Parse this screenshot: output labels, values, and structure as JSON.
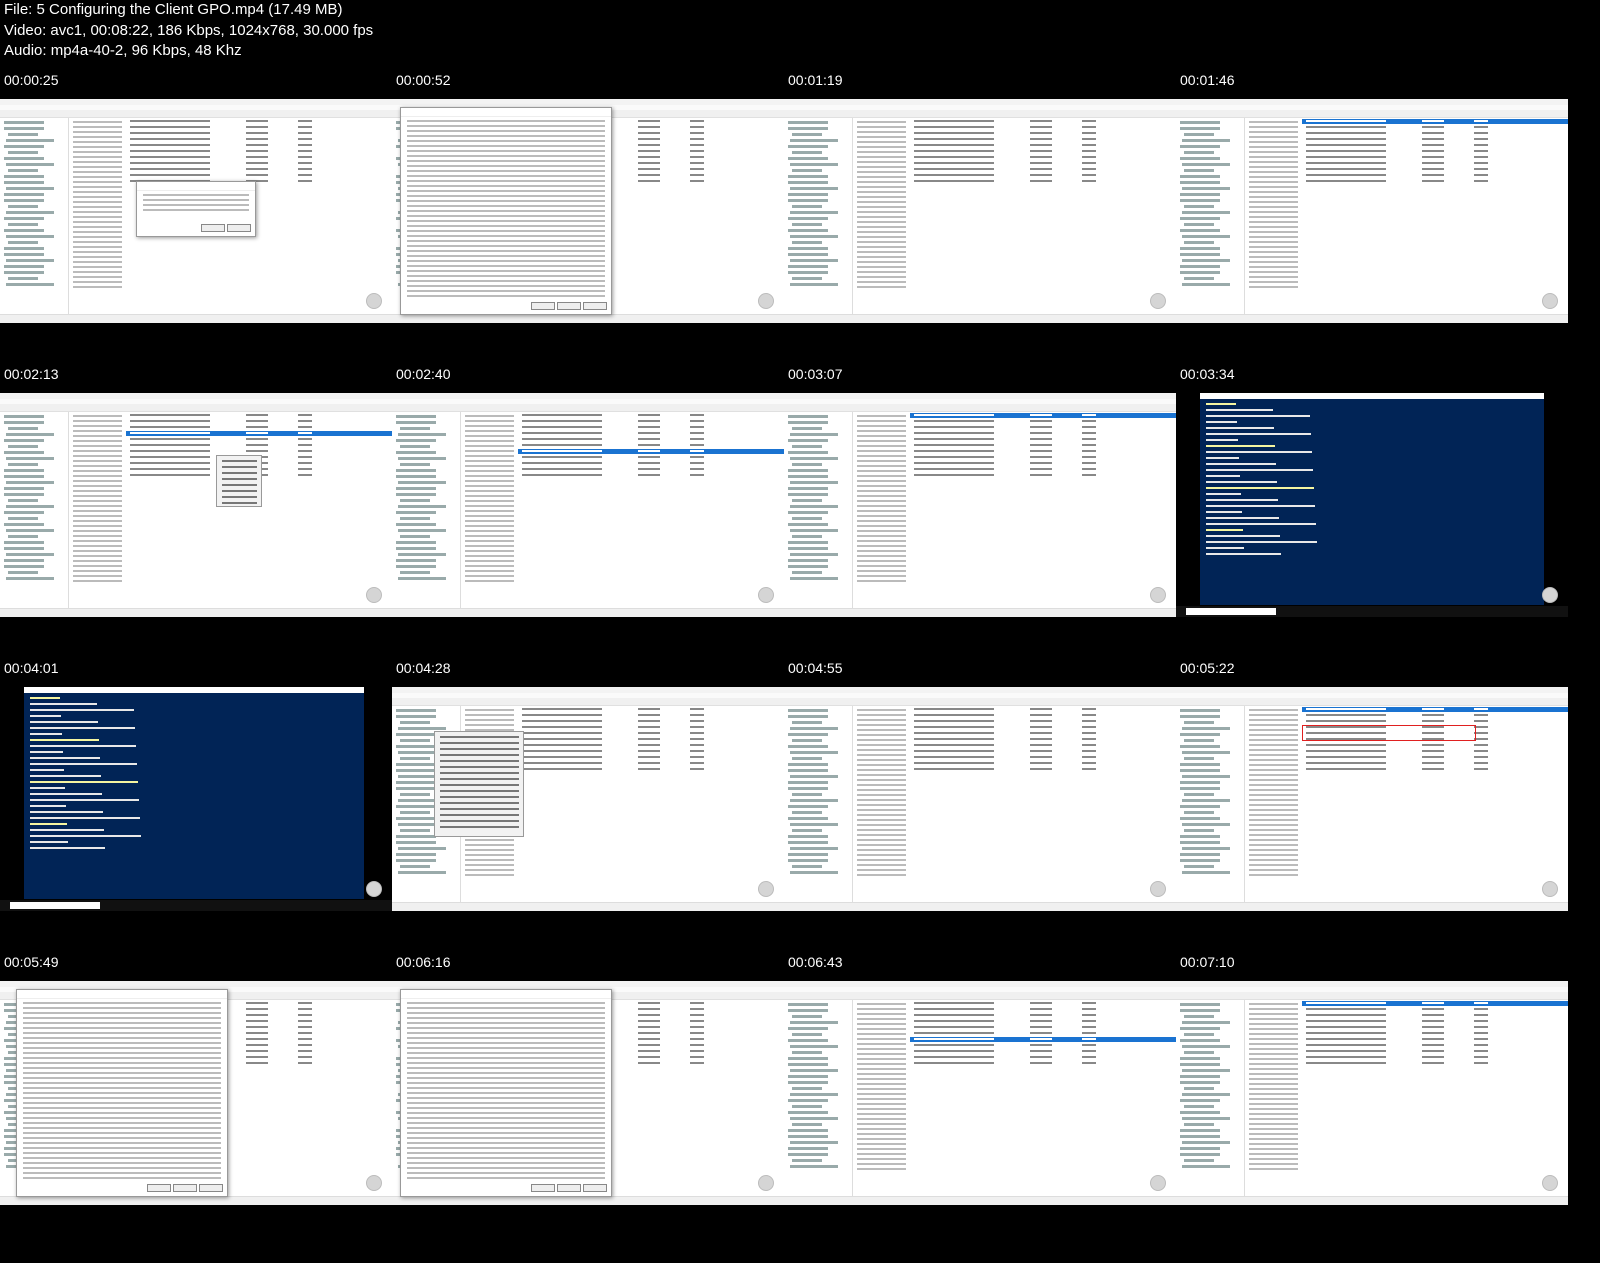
{
  "header": {
    "file_line": "File: 5  Configuring the Client GPO.mp4 (17.49 MB)",
    "video_line": "Video: avc1, 00:08:22, 186 Kbps, 1024x768, 30.000 fps",
    "audio_line": "Audio: mp4a-40-2, 96 Kbps, 48 Khz"
  },
  "thumbnails": [
    {
      "time": "00:00:25",
      "kind": "gpmc-dialog"
    },
    {
      "time": "00:00:52",
      "kind": "policy-dialog"
    },
    {
      "time": "00:01:19",
      "kind": "editor"
    },
    {
      "time": "00:01:46",
      "kind": "editor-sel"
    },
    {
      "time": "00:02:13",
      "kind": "editor-menu"
    },
    {
      "time": "00:02:40",
      "kind": "editor-sel"
    },
    {
      "time": "00:03:07",
      "kind": "editor-sel"
    },
    {
      "time": "00:03:34",
      "kind": "powershell"
    },
    {
      "time": "00:04:01",
      "kind": "powershell-left"
    },
    {
      "time": "00:04:28",
      "kind": "gpmc-menu"
    },
    {
      "time": "00:04:55",
      "kind": "editor"
    },
    {
      "time": "00:05:22",
      "kind": "editor-red"
    },
    {
      "time": "00:05:49",
      "kind": "policy-dialog-left"
    },
    {
      "time": "00:06:16",
      "kind": "policy-dialog"
    },
    {
      "time": "00:06:43",
      "kind": "editor-sel"
    },
    {
      "time": "00:07:10",
      "kind": "editor-sel"
    }
  ]
}
